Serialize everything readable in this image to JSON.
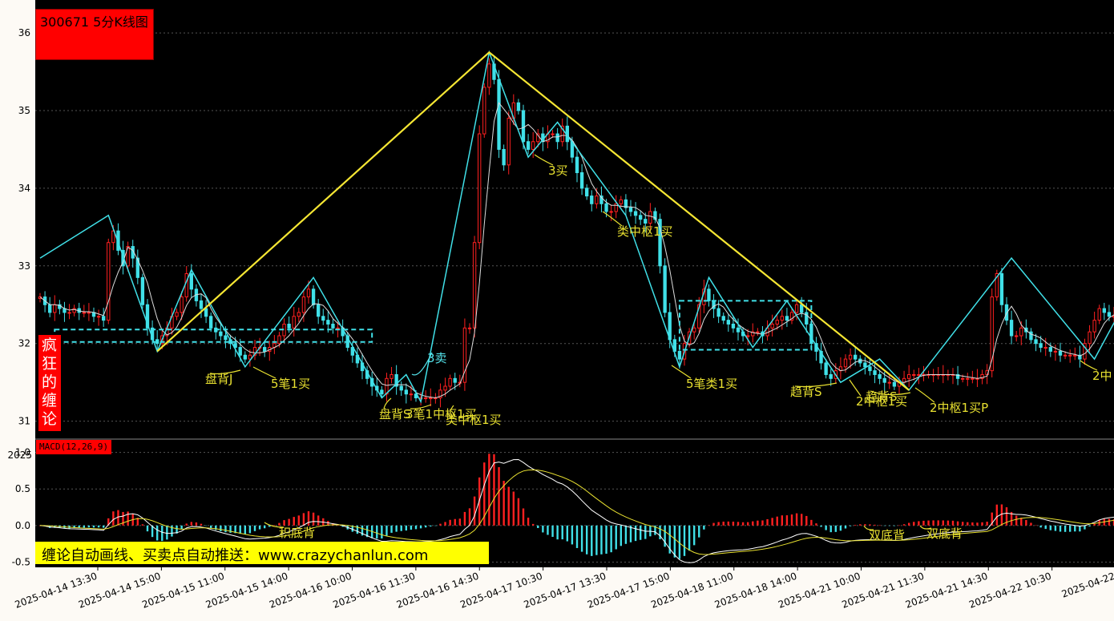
{
  "chart_data": {
    "type": "candlestick",
    "title": "300671 5分K线图",
    "side_label": "疯狂的缠论",
    "price_axis": {
      "ticks": [
        31,
        32,
        33,
        34,
        35,
        36
      ],
      "range": [
        30.8,
        36.3
      ]
    },
    "macd_panel": {
      "label": "MACD(12,26,9)",
      "ticks": [
        "1.0",
        "0.5",
        "0.0",
        "-0.5"
      ],
      "overlap_label": "2025",
      "range": [
        -0.55,
        1.05
      ]
    },
    "x_tick_labels": [
      "2025-04-14 13:30",
      "2025-04-14 15:00",
      "2025-04-15 11:00",
      "2025-04-15 14:00",
      "2025-04-16 10:00",
      "2025-04-16 11:30",
      "2025-04-16 14:30",
      "2025-04-17 10:30",
      "2025-04-17 13:30",
      "2025-04-17 15:00",
      "2025-04-18 11:00",
      "2025-04-18 14:00",
      "2025-04-21 10:00",
      "2025-04-21 11:30",
      "2025-04-21 14:30",
      "2025-04-22 10:30",
      "2025-04-22"
    ],
    "bi_path": [
      {
        "i": 0,
        "p": 33.1
      },
      {
        "i": 14,
        "p": 33.65
      },
      {
        "i": 24,
        "p": 31.9
      },
      {
        "i": 31,
        "p": 32.95
      },
      {
        "i": 42,
        "p": 31.7
      },
      {
        "i": 56,
        "p": 32.85
      },
      {
        "i": 70,
        "p": 31.3
      },
      {
        "i": 75,
        "p": 31.6
      },
      {
        "i": 78,
        "p": 31.25
      },
      {
        "i": 92,
        "p": 35.75
      },
      {
        "i": 100,
        "p": 34.4
      },
      {
        "i": 106,
        "p": 34.85
      },
      {
        "i": 120,
        "p": 33.65
      },
      {
        "i": 131,
        "p": 31.7
      },
      {
        "i": 137,
        "p": 32.85
      },
      {
        "i": 146,
        "p": 31.95
      },
      {
        "i": 153,
        "p": 32.55
      },
      {
        "i": 164,
        "p": 31.5
      },
      {
        "i": 172,
        "p": 31.8
      },
      {
        "i": 178,
        "p": 31.4
      },
      {
        "i": 199,
        "p": 33.1
      },
      {
        "i": 216,
        "p": 31.8
      },
      {
        "i": 222,
        "p": 32.5
      },
      {
        "i": 226,
        "p": 32.35
      }
    ],
    "segment_path": [
      {
        "i": 24,
        "p": 31.9
      },
      {
        "i": 92,
        "p": 35.75
      },
      {
        "i": 178,
        "p": 31.4
      }
    ],
    "pivot_zones": [
      {
        "i0": 3,
        "i1": 68,
        "top": 32.18,
        "bottom": 32.02
      },
      {
        "i0": 131,
        "i1": 158,
        "top": 32.55,
        "bottom": 31.92
      }
    ],
    "annotations": [
      {
        "text": "盘背J",
        "color": "yellow"
      },
      {
        "text": "5笔1买",
        "color": "yellow"
      },
      {
        "text": "3卖",
        "color": "cyan"
      },
      {
        "text": "盘背S",
        "color": "yellow"
      },
      {
        "text": "3笔1中枢1买",
        "color": "yellow"
      },
      {
        "text": "类中枢1买",
        "color": "yellow"
      },
      {
        "text": "3买",
        "color": "yellow"
      },
      {
        "text": "类中枢1买",
        "color": "yellow"
      },
      {
        "text": "5笔类1买",
        "color": "yellow"
      },
      {
        "text": "趋背S",
        "color": "yellow"
      },
      {
        "text": "2中枢1买",
        "color": "yellow"
      },
      {
        "text": "趋背S",
        "color": "yellow"
      },
      {
        "text": "2中枢1买P",
        "color": "yellow"
      },
      {
        "text": "2中",
        "color": "yellow"
      },
      {
        "text": "积底背",
        "color": "yellow"
      },
      {
        "text": "双底背",
        "color": "yellow"
      },
      {
        "text": "双底背",
        "color": "yellow"
      }
    ],
    "candles_close": [
      32.6,
      32.5,
      32.4,
      32.5,
      32.45,
      32.4,
      32.4,
      32.45,
      32.4,
      32.4,
      32.4,
      32.35,
      32.35,
      32.3,
      33.3,
      33.45,
      33.2,
      33.0,
      33.25,
      33.1,
      32.85,
      32.5,
      32.2,
      32.05,
      32.0,
      32.1,
      32.2,
      32.35,
      32.4,
      32.6,
      32.9,
      32.7,
      32.55,
      32.45,
      32.35,
      32.2,
      32.15,
      32.1,
      32.05,
      32.0,
      31.95,
      31.85,
      31.8,
      31.85,
      31.95,
      31.95,
      31.9,
      31.95,
      32.0,
      32.1,
      32.25,
      32.2,
      32.35,
      32.4,
      32.6,
      32.7,
      32.5,
      32.35,
      32.3,
      32.25,
      32.2,
      32.2,
      32.1,
      31.95,
      31.85,
      31.75,
      31.65,
      31.55,
      31.45,
      31.4,
      31.35,
      31.55,
      31.6,
      31.45,
      31.4,
      31.35,
      31.35,
      31.3,
      31.3,
      31.3,
      31.3,
      31.3,
      31.4,
      31.45,
      31.55,
      31.5,
      31.5,
      32.2,
      32.2,
      33.3,
      34.7,
      35.3,
      35.6,
      35.4,
      34.5,
      34.3,
      34.9,
      35.1,
      35.0,
      34.6,
      34.5,
      34.6,
      34.7,
      34.6,
      34.7,
      34.7,
      34.6,
      34.8,
      34.6,
      34.4,
      34.2,
      34.0,
      33.9,
      33.8,
      33.9,
      33.8,
      33.7,
      33.7,
      33.8,
      33.85,
      33.75,
      33.7,
      33.65,
      33.6,
      33.55,
      33.7,
      33.6,
      33.0,
      32.4,
      32.05,
      31.9,
      31.8,
      32.0,
      32.15,
      32.2,
      32.5,
      32.7,
      32.55,
      32.45,
      32.35,
      32.3,
      32.25,
      32.2,
      32.15,
      32.1,
      32.1,
      32.15,
      32.15,
      32.1,
      32.2,
      32.25,
      32.3,
      32.35,
      32.3,
      32.4,
      32.5,
      32.4,
      32.25,
      32.0,
      31.9,
      31.75,
      31.6,
      31.55,
      31.65,
      31.7,
      31.8,
      31.85,
      31.8,
      31.75,
      31.7,
      31.65,
      31.6,
      31.55,
      31.5,
      31.5,
      31.45,
      31.5,
      31.55,
      31.6,
      31.6,
      31.6,
      31.6,
      31.6,
      31.6,
      31.6,
      31.6,
      31.6,
      31.6,
      31.55,
      31.55,
      31.55,
      31.55,
      31.55,
      31.6,
      31.65,
      32.6,
      32.9,
      32.5,
      32.3,
      32.1,
      32.1,
      32.2,
      32.15,
      32.05,
      32.0,
      31.95,
      31.95,
      31.9,
      31.9,
      31.85,
      31.85,
      31.85,
      31.85,
      31.8,
      32.0,
      32.15,
      32.3,
      32.45,
      32.4,
      32.35,
      32.35
    ]
  }
}
